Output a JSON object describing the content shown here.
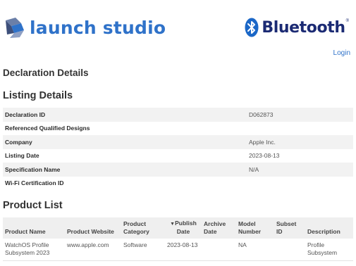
{
  "header": {
    "brand": "launch studio",
    "partner_brand": "Bluetooth",
    "partner_mark": "®",
    "login_label": "Login"
  },
  "colors": {
    "brand_blue": "#2f72c9",
    "bluetooth_navy": "#1b2a73",
    "row_stripe": "#f2f2f2"
  },
  "page_title": "Declaration Details",
  "listing": {
    "title": "Listing Details",
    "rows": [
      {
        "label": "Declaration ID",
        "value": "D062873"
      },
      {
        "label": "Referenced Qualified Designs",
        "value": ""
      },
      {
        "label": "Company",
        "value": "Apple Inc."
      },
      {
        "label": "Listing Date",
        "value": "2023-08-13"
      },
      {
        "label": "Specification Name",
        "value": "N/A"
      },
      {
        "label": "Wi-Fi Certification ID",
        "value": ""
      }
    ]
  },
  "products": {
    "title": "Product List",
    "columns": {
      "name": "Product Name",
      "website": "Product Website",
      "category": "Product Category",
      "publish_arrow": "▼",
      "publish": "Publish Date",
      "archive": "Archive Date",
      "model": "Model Number",
      "subset": "Subset ID",
      "description": "Description"
    },
    "rows": [
      {
        "name": "WatchOS Profile Subsystem 2023",
        "website": "www.apple.com",
        "category": "Software",
        "publish": "2023-08-13",
        "archive": "",
        "model": "NA",
        "subset": "",
        "description": "Profile Subsystem"
      }
    ]
  }
}
